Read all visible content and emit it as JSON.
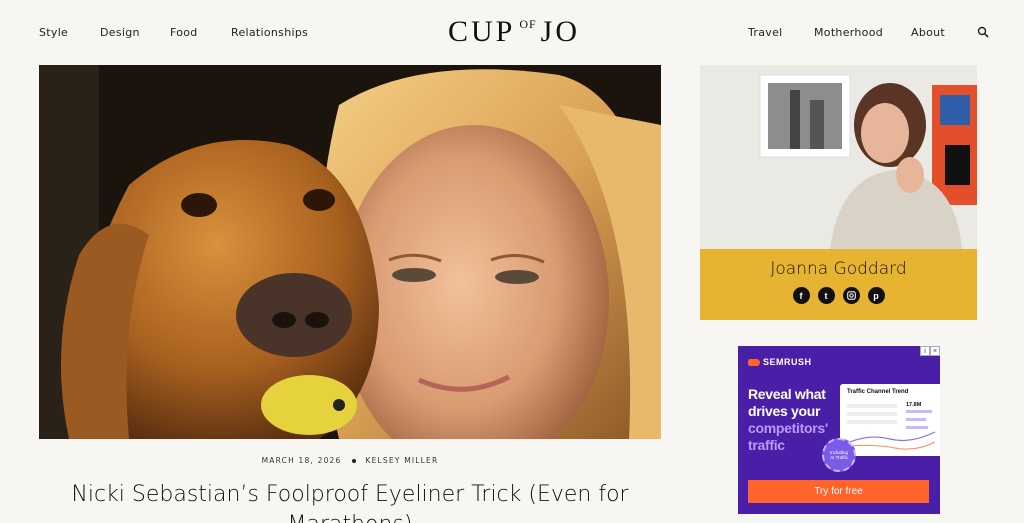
{
  "nav": {
    "left": [
      "Style",
      "Design",
      "Food",
      "Relationships"
    ],
    "right": [
      "Travel",
      "Motherhood",
      "About"
    ]
  },
  "logo": {
    "part1": "CUP",
    "part2": "OF",
    "part3": "JO"
  },
  "article": {
    "date": "MARCH 18, 2026",
    "author": "KELSEY MILLER",
    "title": "Nicki Sebastian’s Foolproof Eyeliner Trick (Even for Marathons)"
  },
  "sidebar": {
    "author_name": "Joanna Goddard",
    "socials": [
      "facebook-icon",
      "twitter-icon",
      "instagram-icon",
      "pinterest-icon"
    ]
  },
  "ad": {
    "brand": "SEMRUSH",
    "headline_a": "Reveal what drives your",
    "headline_b": "competitors' traffic",
    "panel_title": "Traffic Channel Trend",
    "panel_value": "17.8M",
    "badge_text": "Including AI Traffic",
    "cta": "Try for free",
    "colors": {
      "bg": "#4a1fa8",
      "accent": "#ff642d",
      "highlight": "#b49cff"
    }
  }
}
